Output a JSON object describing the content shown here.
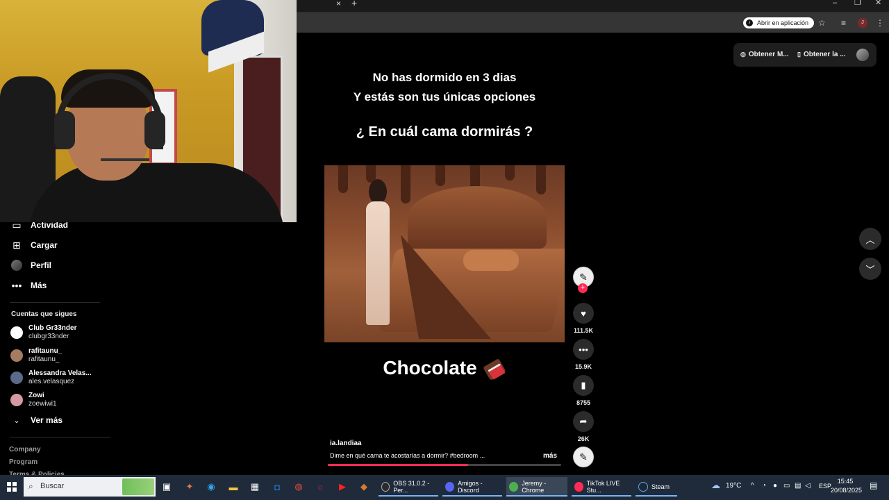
{
  "browser": {
    "tab_close": "×",
    "tab_new": "+",
    "open_app_label": "Abrir en aplicación",
    "profile_initial": "J"
  },
  "header_pills": {
    "get_coins": "Obtener M...",
    "get_app": "Obtener la ..."
  },
  "sidebar": {
    "items": [
      {
        "label": "Actividad",
        "icon": "inbox-icon"
      },
      {
        "label": "Cargar",
        "icon": "upload-plus-icon"
      },
      {
        "label": "Perfil",
        "icon": "profile-avatar"
      },
      {
        "label": "Más",
        "icon": "more-icon"
      }
    ],
    "following_title": "Cuentas que sigues",
    "following": [
      {
        "name": "Club Gr33nder",
        "handle": "clubgr33nder"
      },
      {
        "name": "rafitaunu_",
        "handle": "rafitaunu_"
      },
      {
        "name": "Alessandra Velas...",
        "handle": "ales.velasquez"
      },
      {
        "name": "Zowi",
        "handle": "zoewiwi1"
      }
    ],
    "see_more": "Ver más",
    "footer": [
      "Company",
      "Program",
      "Terms & Policies"
    ]
  },
  "video": {
    "overlay_line1": "No has dormido en 3 dias",
    "overlay_line2": "Y estás son tus únicas opciones",
    "overlay_question": "¿ En cuál cama dormirás ?",
    "caption": "Chocolate",
    "author": "ia.landiaa",
    "description": "Dime en qué cama te acostarías a dormir? #bedroom ...",
    "more": "más",
    "progress": 0.6
  },
  "actions": {
    "follow_plus": "+",
    "likes": "111.5K",
    "comments": "15.9K",
    "saves": "8755",
    "shares": "26K"
  },
  "taskbar": {
    "search_placeholder": "Buscar",
    "apps": [
      {
        "label": "OBS 31.0.2 - Per...",
        "color": "#2b2b2b"
      },
      {
        "label": "Amigos - Discord",
        "color": "#5865f2"
      },
      {
        "label": "Jeremy - Chrome",
        "color": "#4caf50"
      },
      {
        "label": "TikTok LIVE Stu...",
        "color": "#fe2c55"
      },
      {
        "label": "Steam",
        "color": "#1b2838"
      }
    ],
    "temperature": "19°C",
    "language": "ESP",
    "time": "15:45",
    "date": "20/08/2025"
  }
}
